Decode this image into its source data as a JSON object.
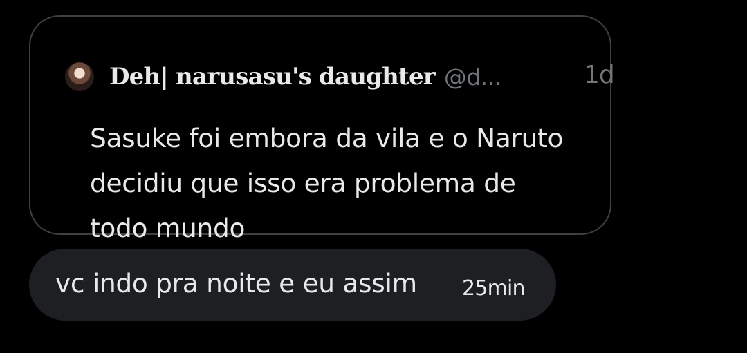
{
  "quote": {
    "author_name": "Deh| narusasu's daughter",
    "author_handle": "@d...",
    "time": "1d",
    "text_line1": "Sasuke foi embora da vila e o Naruto",
    "text_line2": "decidiu que isso era problema de",
    "text_line3": "todo mundo"
  },
  "reply": {
    "text": "vc indo pra noite e eu assim",
    "time": "25min"
  }
}
